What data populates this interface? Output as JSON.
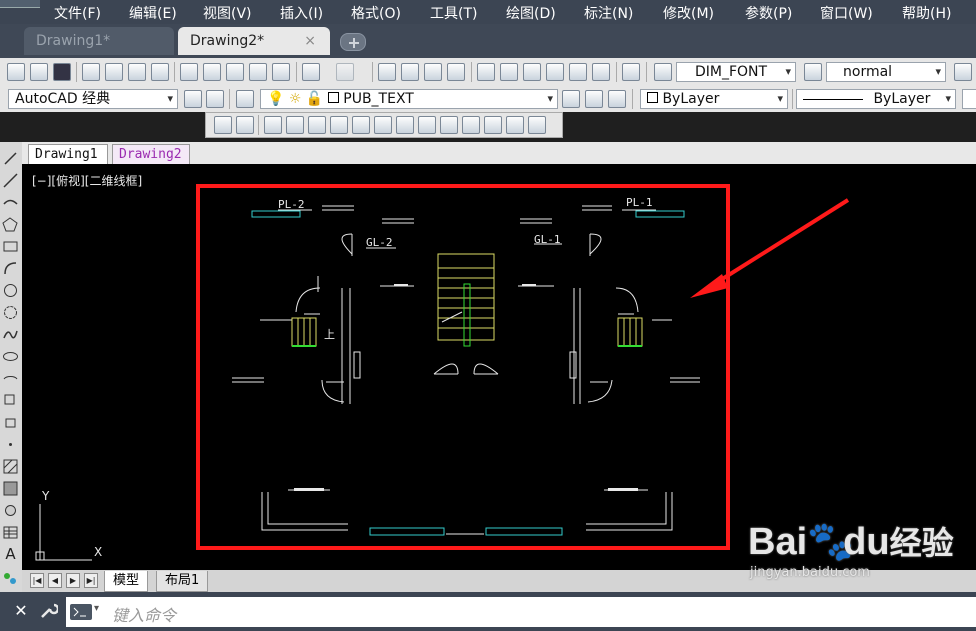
{
  "menubar": {
    "items": [
      "文件(F)",
      "编辑(E)",
      "视图(V)",
      "插入(I)",
      "格式(O)",
      "工具(T)",
      "绘图(D)",
      "标注(N)",
      "修改(M)",
      "参数(P)",
      "窗口(W)",
      "帮助(H)"
    ]
  },
  "doc_tabs": [
    {
      "label": "Drawing1*"
    },
    {
      "label": "Drawing2*",
      "close": "×"
    }
  ],
  "toolbar1": {
    "text_style": "DIM_FONT",
    "dim_style": "normal"
  },
  "toolbar2": {
    "workspace": "AutoCAD 经典",
    "layer": "PUB_TEXT",
    "color": "ByLayer",
    "linetype": "ByLayer"
  },
  "drawing_tabs": [
    "Drawing1",
    "Drawing2"
  ],
  "viewport_label": "[−][俯视][二维线框]",
  "drawing": {
    "labels": [
      "PL-2",
      "PL-1",
      "GL-2",
      "GL-1",
      "上"
    ],
    "ucs_x": "X",
    "ucs_y": "Y"
  },
  "layout_tabs": [
    "模型",
    "布局1"
  ],
  "command": {
    "placeholder": "键入命令"
  },
  "watermark": {
    "brand_a": "Bai",
    "brand_b": "du",
    "brand_c": "经验",
    "url": "jingyan.baidu.com"
  },
  "colors": {
    "highlight_red": "#ff1a1a",
    "window_cyan": "#33cccc",
    "stair_green": "#33dd33",
    "stair_yellow": "#dddd66"
  }
}
